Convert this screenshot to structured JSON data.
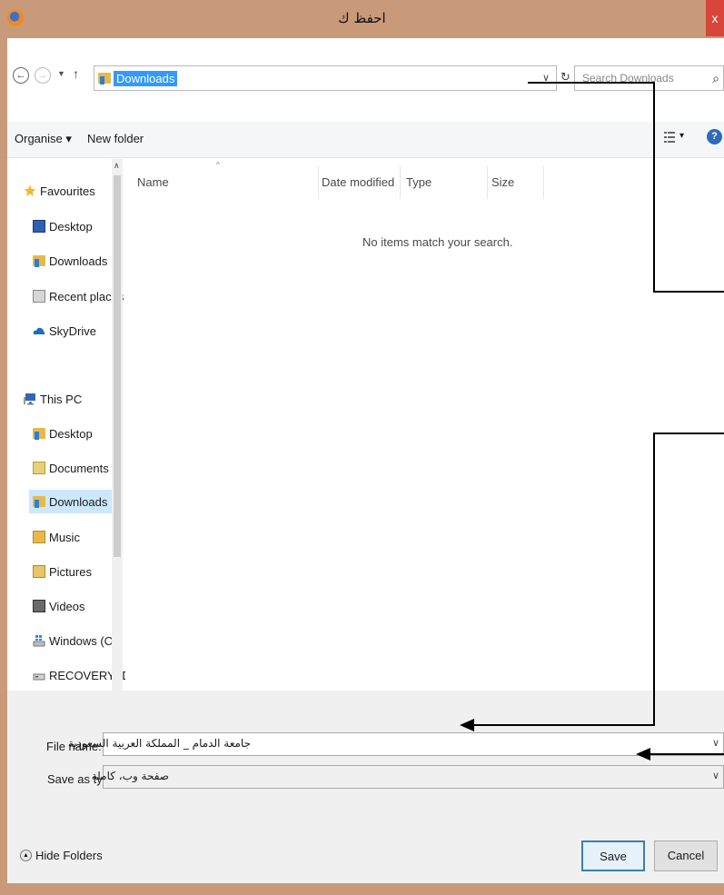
{
  "window": {
    "title": "احفظ ك",
    "close_label": "x"
  },
  "address": {
    "path": "Downloads",
    "search_placeholder": "Search Downloads"
  },
  "toolbar": {
    "organise": "Organise ▾",
    "new_folder": "New folder",
    "view_arrow": "▾",
    "help": "?"
  },
  "sidebar": {
    "favourites": "Favourites",
    "fav_items": [
      "Desktop",
      "Downloads",
      "Recent places",
      "SkyDrive"
    ],
    "this_pc": "This PC",
    "pc_items": [
      "Desktop",
      "Documents",
      "Downloads",
      "Music",
      "Pictures",
      "Videos",
      "Windows (C:)",
      "RECOVERY (D:)"
    ]
  },
  "file_list": {
    "columns": [
      "Name",
      "Date modified",
      "Type",
      "Size"
    ],
    "empty_message": "No items match your search."
  },
  "save": {
    "file_name_label": "File name:",
    "file_name_value": "جامعة الدمام _ المملكة العربية السعودية",
    "type_label": "Save as type:",
    "type_value": "صفحة وب، كاملة",
    "hide_folders": "Hide Folders",
    "save_button": "Save",
    "cancel_button": "Cancel"
  },
  "colors": {
    "titlebar": "#c99a7a",
    "selection": "#3399ff",
    "close": "#d9453a"
  }
}
